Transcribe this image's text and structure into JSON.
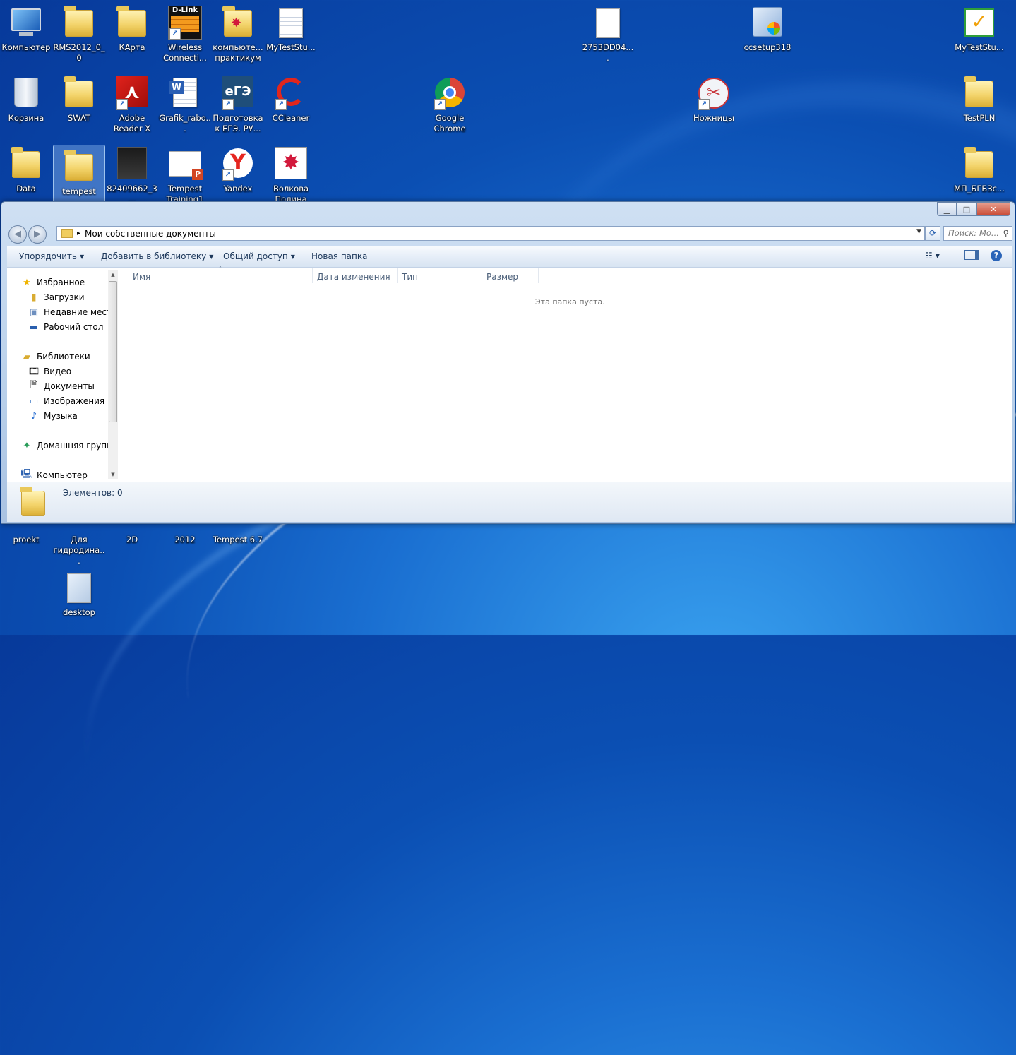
{
  "desktop": {
    "icons": [
      {
        "label": "Компьютер",
        "type": "computer"
      },
      {
        "label": "RMS2012_0_0",
        "type": "folder"
      },
      {
        "label": "КАрта",
        "type": "folder"
      },
      {
        "label": "Wireless Connecti...",
        "type": "app"
      },
      {
        "label": "компьюте... практикум",
        "type": "folder"
      },
      {
        "label": "MyTestStu...",
        "type": "file"
      },
      {
        "label": "2753DD04....",
        "type": "file"
      },
      {
        "label": "ccsetup318",
        "type": "setup"
      },
      {
        "label": "MyTestStu...",
        "type": "app"
      },
      {
        "label": "Корзина",
        "type": "recycle"
      },
      {
        "label": "SWAT",
        "type": "folder"
      },
      {
        "label": "Adobe Reader X",
        "type": "pdf"
      },
      {
        "label": "Grafik_rabo...",
        "type": "word"
      },
      {
        "label": "Подготовка к ЕГЭ. РУ...",
        "type": "app"
      },
      {
        "label": "CCleaner",
        "type": "app"
      },
      {
        "label": "Google Chrome",
        "type": "chrome"
      },
      {
        "label": "Ножницы",
        "type": "app"
      },
      {
        "label": "TestPLN",
        "type": "folder"
      },
      {
        "label": "Data",
        "type": "folder"
      },
      {
        "label": "tempest",
        "type": "folder"
      },
      {
        "label": "82409662_3...",
        "type": "image"
      },
      {
        "label": "Tempest Training1",
        "type": "ppt"
      },
      {
        "label": "Yandex",
        "type": "yandex"
      },
      {
        "label": "Волкова Полина",
        "type": "app"
      },
      {
        "label": "МП_БГБЗс...",
        "type": "folder"
      },
      {
        "label": "proekt",
        "type": "folder"
      },
      {
        "label": "Для гидродина...",
        "type": "folder"
      },
      {
        "label": "2D",
        "type": "app"
      },
      {
        "label": "2012",
        "type": "app"
      },
      {
        "label": "Tempest 6.7",
        "type": "app"
      },
      {
        "label": "desktop",
        "type": "file"
      }
    ]
  },
  "window": {
    "caption_buttons": {
      "minimize": "▁",
      "maximize": "□",
      "close": "✕"
    },
    "address": {
      "path": "Мои собственные документы",
      "separator": "▸"
    },
    "search": {
      "placeholder": "Поиск: Мо...",
      "icon": "magnifier-icon"
    },
    "toolbar": {
      "organize": "Упорядочить",
      "add_library": "Добавить в библиотеку",
      "share": "Общий доступ",
      "new_folder": "Новая папка"
    },
    "nav": {
      "favorites": "Избранное",
      "downloads": "Загрузки",
      "recent": "Недавние места",
      "desktop": "Рабочий стол",
      "libraries": "Библиотеки",
      "video": "Видео",
      "documents": "Документы",
      "images": "Изображения",
      "music": "Музыка",
      "homegroup": "Домашняя группа",
      "computer": "Компьютер"
    },
    "columns": [
      "Имя",
      "Дата изменения",
      "Тип",
      "Размер"
    ],
    "empty_text": "Эта папка пуста.",
    "status_text": "Элементов: 0"
  },
  "colors": {
    "desktop_bg": "#0b4fb3",
    "window_frame": "#b9d0ea",
    "close_button": "#c94a34"
  }
}
